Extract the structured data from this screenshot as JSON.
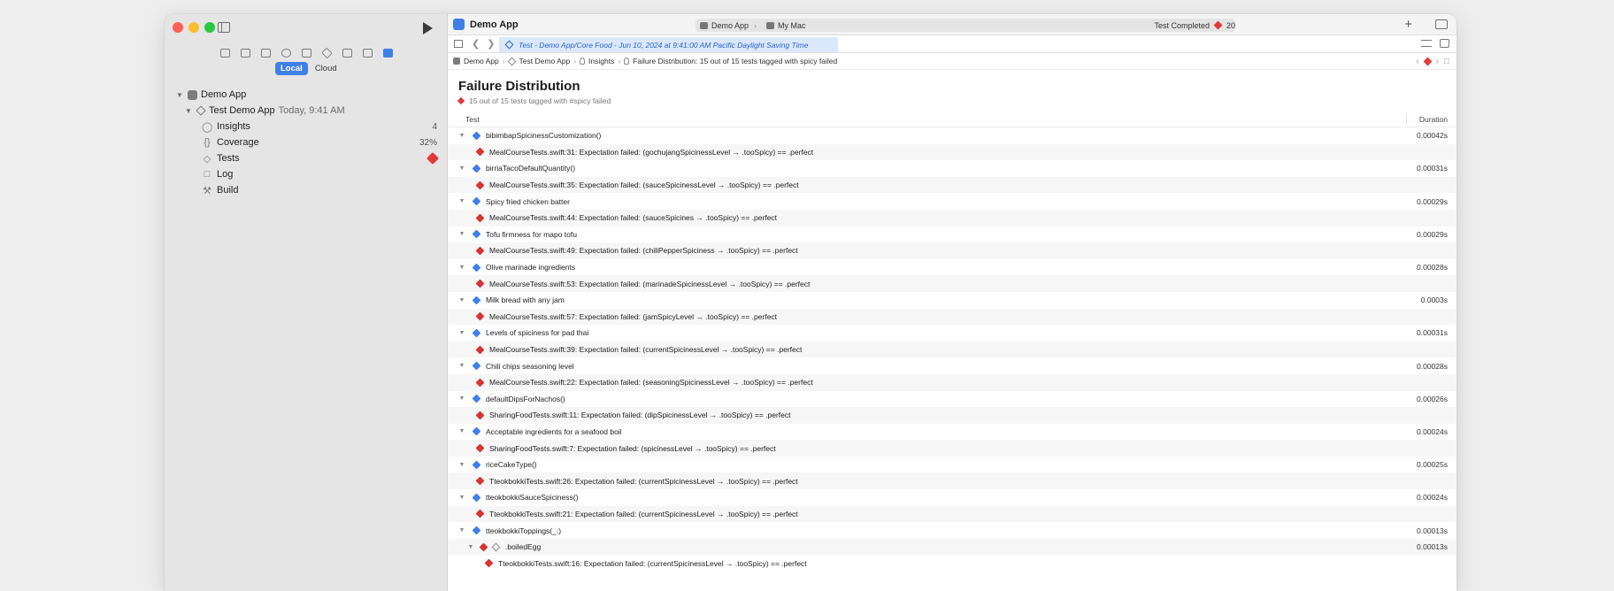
{
  "colors": {
    "accent": "#3f7fe8",
    "error": "#e03a3a",
    "sidebar_bg": "#e6e5e5"
  },
  "sidebar": {
    "tabs": [
      "Local",
      "Cloud"
    ],
    "active_tab": "Local",
    "tree": {
      "app": "Demo App",
      "plan": "Test Demo App",
      "plan_time": "Today, 9:41 AM",
      "items": [
        {
          "label": "Insights",
          "icon": "lightbulb-icon",
          "badge": "4"
        },
        {
          "label": "Coverage",
          "icon": "braces-icon",
          "badge": "32%"
        },
        {
          "label": "Tests",
          "icon": "diamond-icon",
          "badge": "error"
        },
        {
          "label": "Log",
          "icon": "document-icon",
          "badge": ""
        },
        {
          "label": "Build",
          "icon": "hammer-icon",
          "badge": ""
        }
      ]
    }
  },
  "toolbar": {
    "title": "Demo App",
    "scheme": "Demo App",
    "destination": "My Mac",
    "status": "Test Completed",
    "error_count": "20"
  },
  "tab": {
    "label": "Test - Demo App/Core Food - Jun 10, 2024 at 9:41:00 AM Pacific Daylight Saving Time"
  },
  "jumpbar": [
    "Demo App",
    "Test Demo App",
    "Insights",
    "Failure Distribution: 15 out of 15 tests tagged with spicy failed"
  ],
  "report": {
    "title": "Failure Distribution",
    "subtitle": "15 out of 15 tests tagged with #spicy failed",
    "col_test": "Test",
    "col_duration": "Duration",
    "rows": [
      {
        "name": "bibimbapSpicinessCustomization()",
        "duration": "0.00042s",
        "failure": "MealCourseTests.swift:31: Expectation failed: (gochujangSpicinessLevel → .tooSpicy) == .perfect"
      },
      {
        "name": "birriaTacoDefaultQuantity()",
        "duration": "0.00031s",
        "failure": "MealCourseTests.swift:35: Expectation failed: (sauceSpicinessLevel → .tooSpicy) == .perfect"
      },
      {
        "name": "Spicy fried chicken batter",
        "duration": "0.00029s",
        "failure": "MealCourseTests.swift:44: Expectation failed: (sauceSpicines → .tooSpicy) == .perfect"
      },
      {
        "name": "Tofu firmness for mapo tofu",
        "duration": "0.00029s",
        "failure": "MealCourseTests.swift:49: Expectation failed: (chiliPepperSpiciness → .tooSpicy) == .perfect"
      },
      {
        "name": "Olive marinade ingredients",
        "duration": "0.00028s",
        "failure": "MealCourseTests.swift:53: Expectation failed: (marinadeSpicinessLevel → .tooSpicy) == .perfect"
      },
      {
        "name": "Milk bread with any jam",
        "duration": "0.0003s",
        "failure": "MealCourseTests.swift:57: Expectation failed: (jamSpicyLevel → .tooSpicy) == .perfect"
      },
      {
        "name": "Levels of spiciness for pad thai",
        "duration": "0.00031s",
        "failure": "MealCourseTests.swift:39: Expectation failed: (currentSpicinessLevel → .tooSpicy) == .perfect"
      },
      {
        "name": "Chili chips seasoning level",
        "duration": "0.00028s",
        "failure": "MealCourseTests.swift:22: Expectation failed: (seasoningSpicinessLevel → .tooSpicy) == .perfect"
      },
      {
        "name": "defaultDipsForNachos()",
        "duration": "0.00026s",
        "failure": "SharingFoodTests.swift:11: Expectation failed: (dipSpicinessLevel → .tooSpicy) == .perfect"
      },
      {
        "name": "Acceptable ingredients for a seafood boil",
        "duration": "0.00024s",
        "failure": "SharingFoodTests.swift:7: Expectation failed: (spicinessLevel → .tooSpicy) == .perfect"
      },
      {
        "name": "riceCakeType()",
        "duration": "0.00025s",
        "failure": "TteokbokkiTests.swift:26: Expectation failed: (currentSpicinessLevel → .tooSpicy) == .perfect"
      },
      {
        "name": "tteokbokkiSauceSpiciness()",
        "duration": "0.00024s",
        "failure": "TteokbokkiTests.swift:21: Expectation failed: (currentSpicinessLevel → .tooSpicy) == .perfect"
      }
    ],
    "last_row": {
      "name": "tteokbokkiToppings(_:)",
      "duration": "0.00013s",
      "child_name": ".boiledEgg",
      "child_duration": "0.00013s",
      "child_failure": "TteokbokkiTests.swift:16: Expectation failed: (currentSpicinessLevel → .tooSpicy) == .perfect"
    }
  }
}
